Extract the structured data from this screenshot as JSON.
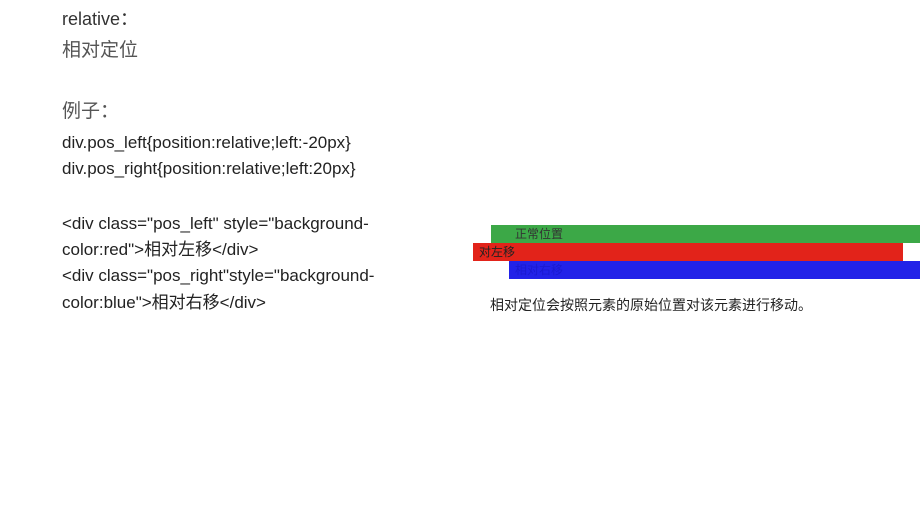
{
  "left": {
    "title": "relative：",
    "subtitle": "相对定位",
    "example_label": "例子：",
    "css1": "div.pos_left{position:relative;left:-20px}",
    "css2": "div.pos_right{position:relative;left:20px}",
    "html1a": "<div class=\"pos_left\" style=\"background-",
    "html1b": "color:red\">相对左移</div>",
    "html2a": "<div class=\"pos_right\"style=\"background-",
    "html2b": "color:blue\">相对右移</div>"
  },
  "demo": {
    "green_label": "正常位置",
    "red_label": "对左移",
    "blue_label": "相对右移"
  },
  "explain": "相对定位会按照元素的原始位置对该元素进行移动。"
}
